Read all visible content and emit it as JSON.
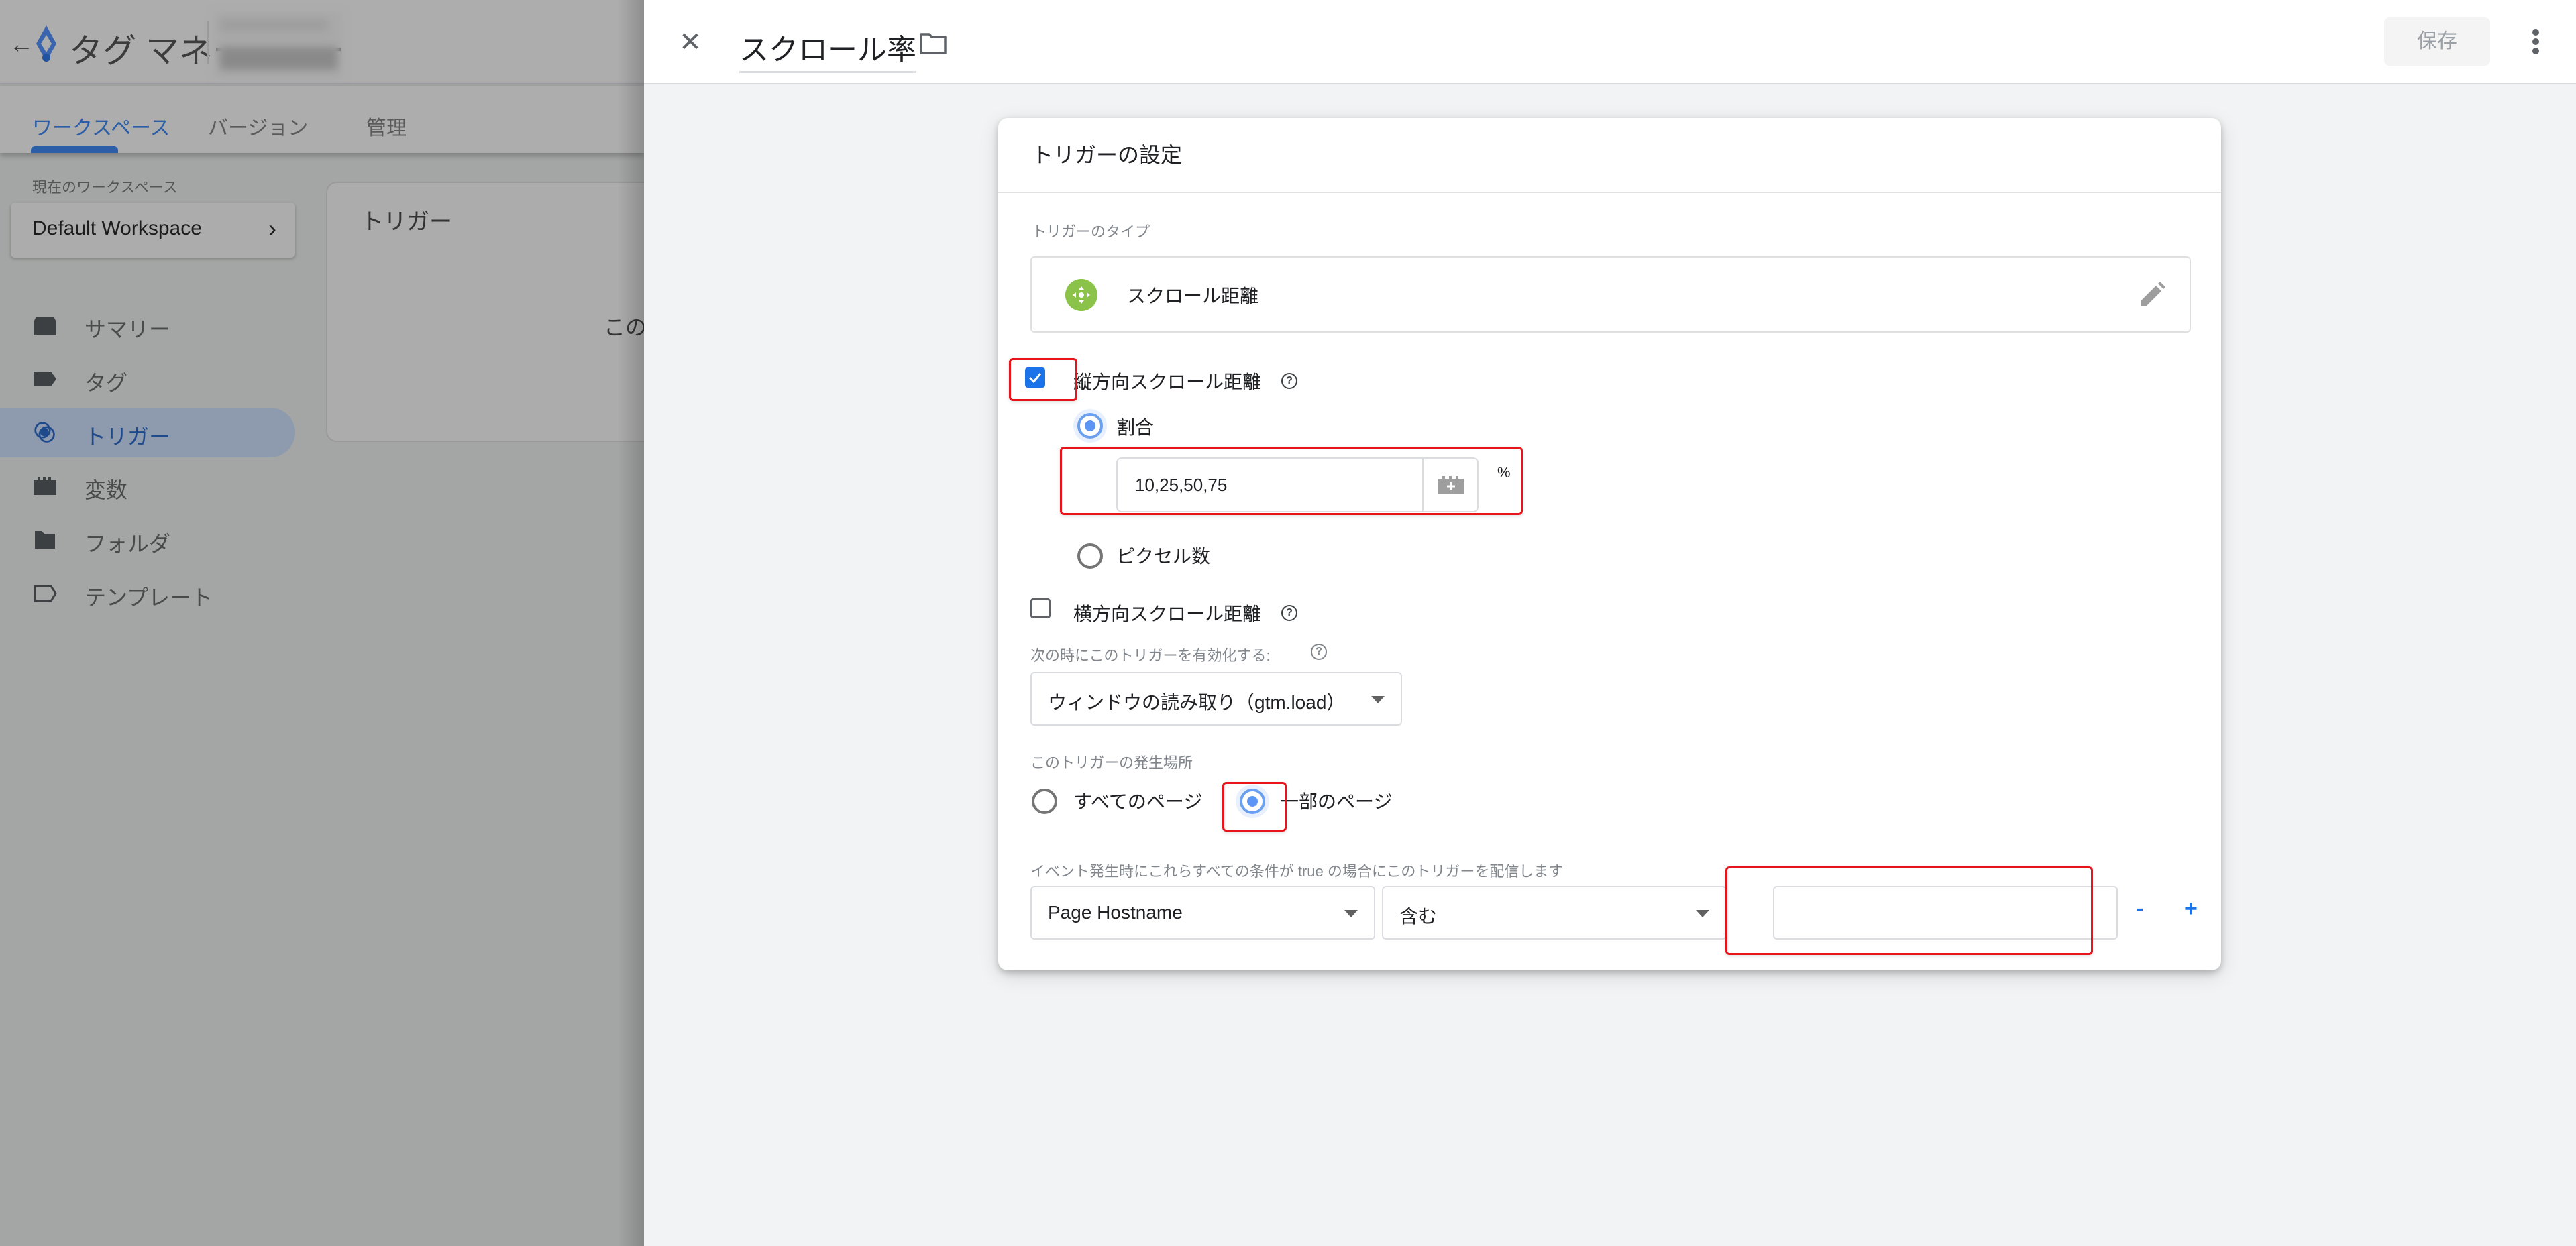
{
  "background_app": {
    "back_icon": "arrow-left-icon",
    "product_name": "タグ マネージャー",
    "account_name_blurred": true,
    "tabs": [
      {
        "label": "ワークスペース",
        "active": true
      },
      {
        "label": "バージョン",
        "active": false
      },
      {
        "label": "管理",
        "active": false
      }
    ],
    "workspace_label": "現在のワークスペース",
    "workspace_name": "Default Workspace",
    "nav": [
      {
        "label": "サマリー",
        "icon": "summary-icon",
        "active": false
      },
      {
        "label": "タグ",
        "icon": "tag-icon",
        "active": false
      },
      {
        "label": "トリガー",
        "icon": "trigger-icon",
        "active": true
      },
      {
        "label": "変数",
        "icon": "variable-icon",
        "active": false
      },
      {
        "label": "フォルダ",
        "icon": "folder-icon",
        "active": false
      },
      {
        "label": "テンプレート",
        "icon": "template-icon",
        "active": false
      }
    ],
    "content_card": {
      "title": "トリガー",
      "text_fragment": "この"
    }
  },
  "panel": {
    "title": "スクロール率",
    "save_label": "保存",
    "card": {
      "title": "トリガーの設定",
      "trigger_type_label": "トリガーのタイプ",
      "trigger_type_name": "スクロール距離",
      "vertical": {
        "label": "縦方向スクロール距離",
        "checked": true,
        "options": [
          {
            "label": "割合",
            "selected": true
          },
          {
            "label": "ピクセル数",
            "selected": false
          }
        ],
        "percent_value": "10,25,50,75",
        "percent_unit": "%"
      },
      "horizontal": {
        "label": "横方向スクロール距離",
        "checked": false
      },
      "enable_when_label": "次の時にこのトリガーを有効化する:",
      "enable_when_value": "ウィンドウの読み取り（gtm.load）",
      "fire_on_label": "このトリガーの発生場所",
      "fire_on_options": [
        {
          "label": "すべてのページ",
          "selected": false
        },
        {
          "label": "一部のページ",
          "selected": true
        }
      ],
      "condition_label": "イベント発生時にこれらすべての条件が true の場合にこのトリガーを配信します",
      "condition": {
        "variable": "Page Hostname",
        "operator": "含む",
        "value": ""
      },
      "remove_label": "-",
      "add_label": "+"
    }
  },
  "colors": {
    "accent": "#1a73e8",
    "highlight": "#e8141b",
    "trigger_type_icon": "#8bc34a"
  }
}
